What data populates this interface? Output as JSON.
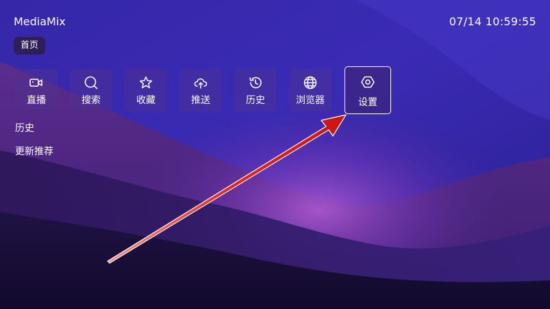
{
  "app": {
    "title": "MediaMix",
    "clock": "07/14 10:59:55"
  },
  "tabs": [
    {
      "label": "首页",
      "selected": true
    }
  ],
  "menu": {
    "selected_index": 6,
    "items": [
      {
        "label": "直播",
        "icon": "video-camera-icon"
      },
      {
        "label": "搜索",
        "icon": "search-icon"
      },
      {
        "label": "收藏",
        "icon": "star-icon"
      },
      {
        "label": "推送",
        "icon": "cloud-upload-icon"
      },
      {
        "label": "历史",
        "icon": "history-clock-icon"
      },
      {
        "label": "浏览器",
        "icon": "globe-icon"
      },
      {
        "label": "设置",
        "icon": "hexagon-settings-icon"
      }
    ]
  },
  "sections": [
    {
      "label": "历史"
    },
    {
      "label": "更新推荐"
    }
  ],
  "colors": {
    "arrow": "#e8231f",
    "tile_bg": "#50328c",
    "selected_border": "#ffffff"
  }
}
